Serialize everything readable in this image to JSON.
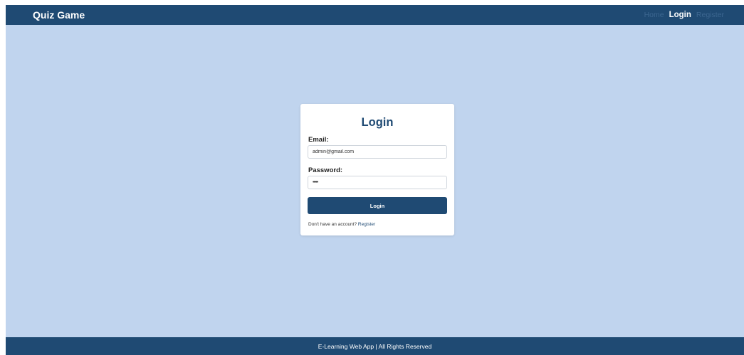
{
  "navbar": {
    "brand": "Quiz Game",
    "links": [
      {
        "label": "Home"
      },
      {
        "label": "Login"
      },
      {
        "label": "Register"
      }
    ]
  },
  "login_form": {
    "title": "Login",
    "email_label": "Email:",
    "email_value": "admin@gmail.com",
    "password_label": "Password:",
    "password_value": "admin",
    "submit_label": "Login",
    "register_prompt": "Don't have an account?",
    "register_link": "Register"
  },
  "footer": {
    "text": "E-Learning Web App | All Rights Reserved"
  },
  "colors": {
    "primary": "#1f4a73",
    "background": "#c0d4ee"
  }
}
